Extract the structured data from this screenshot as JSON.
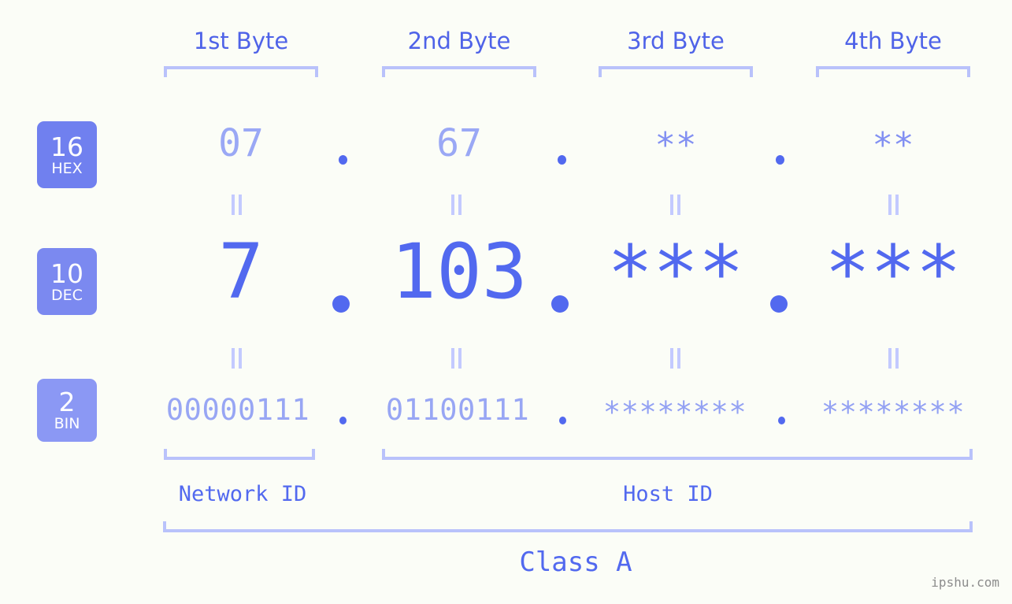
{
  "page": {
    "background_color": "#fbfdf7",
    "accent_color": "#5269ef",
    "bracket_color": "#b9c2fb",
    "badge_color": "#7080ef",
    "watermark": "ipshu.com"
  },
  "header": {
    "byte_labels": [
      {
        "label": "1st Byte"
      },
      {
        "label": "2nd Byte"
      },
      {
        "label": "3rd Byte"
      },
      {
        "label": "4th Byte"
      }
    ]
  },
  "rows": {
    "hex": {
      "badge_number": "16",
      "badge_name": "HEX",
      "values": [
        "07",
        "67",
        "**",
        "**"
      ],
      "separator": "."
    },
    "dec": {
      "badge_number": "10",
      "badge_name": "DEC",
      "values": [
        "7",
        "103",
        "***",
        "***"
      ],
      "separator": "."
    },
    "bin": {
      "badge_number": "2",
      "badge_name": "BIN",
      "values": [
        "00000111",
        "01100111",
        "********",
        "********"
      ],
      "separator": "."
    }
  },
  "connectors": {
    "symbol": "="
  },
  "footer": {
    "network_id_label": "Network ID",
    "host_id_label": "Host ID",
    "class_label": "Class A"
  }
}
